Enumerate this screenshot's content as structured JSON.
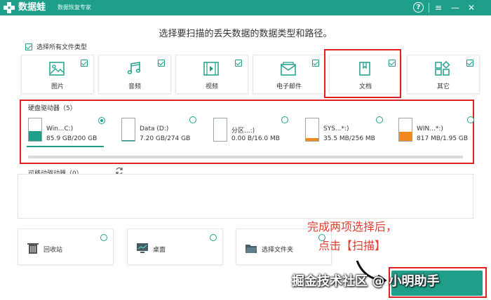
{
  "titlebar": {
    "app_name": "数据蛙",
    "subtitle": "数据恢复专家",
    "help": "?",
    "menu": "≡",
    "minimize": "—",
    "close": "✕"
  },
  "page_title": "选择要扫描的丢失数据的数据类型和路径。",
  "select_all_label": "选择所有文件类型",
  "file_types": [
    {
      "label": "图片",
      "icon": "image-icon",
      "checked": true
    },
    {
      "label": "音频",
      "icon": "audio-icon",
      "checked": true
    },
    {
      "label": "视频",
      "icon": "video-icon",
      "checked": true
    },
    {
      "label": "电子邮件",
      "icon": "email-icon",
      "checked": true
    },
    {
      "label": "文档",
      "icon": "document-icon",
      "checked": true
    },
    {
      "label": "其它",
      "icon": "other-icon",
      "checked": true
    }
  ],
  "hard_drives": {
    "label": "硬盘驱动器（5）",
    "items": [
      {
        "name": "Win...C:)",
        "size": "85.9 GB/200 GB",
        "used_fraction": 0.43,
        "fill_color": "#1f9e8a",
        "selected": true
      },
      {
        "name": "Data (D:)",
        "size": "7.20 GB/274 GB",
        "used_fraction": 0.03,
        "fill_color": "#1f9e8a",
        "selected": false
      },
      {
        "name": "分区...:)",
        "size": "0.00  B/16.0 MB",
        "used_fraction": 0.0,
        "fill_color": "#1f9e8a",
        "selected": false
      },
      {
        "name": "SYS...*:)",
        "size": "35.5 MB/256 MB",
        "used_fraction": 0.14,
        "fill_color": "#f08a1c",
        "selected": false
      },
      {
        "name": "WIN...*:)",
        "size": "817 MB/1.95 GB",
        "used_fraction": 0.42,
        "fill_color": "#f08a1c",
        "selected": false
      }
    ]
  },
  "removable": {
    "label": "可移动驱动器（0）"
  },
  "locations": [
    {
      "label": "回收站",
      "icon": "recycle-bin-icon"
    },
    {
      "label": "桌面",
      "icon": "desktop-icon"
    },
    {
      "label": "选择文件夹",
      "icon": "folder-icon"
    }
  ],
  "annotation": {
    "line1": "完成两项选择后，",
    "line2": "点击【扫描】"
  },
  "watermark": "掘金技术社区 @ 小明助手",
  "colors": {
    "accent": "#1f9e8a",
    "highlight": "#e02020",
    "annotation": "#e63c2f"
  }
}
